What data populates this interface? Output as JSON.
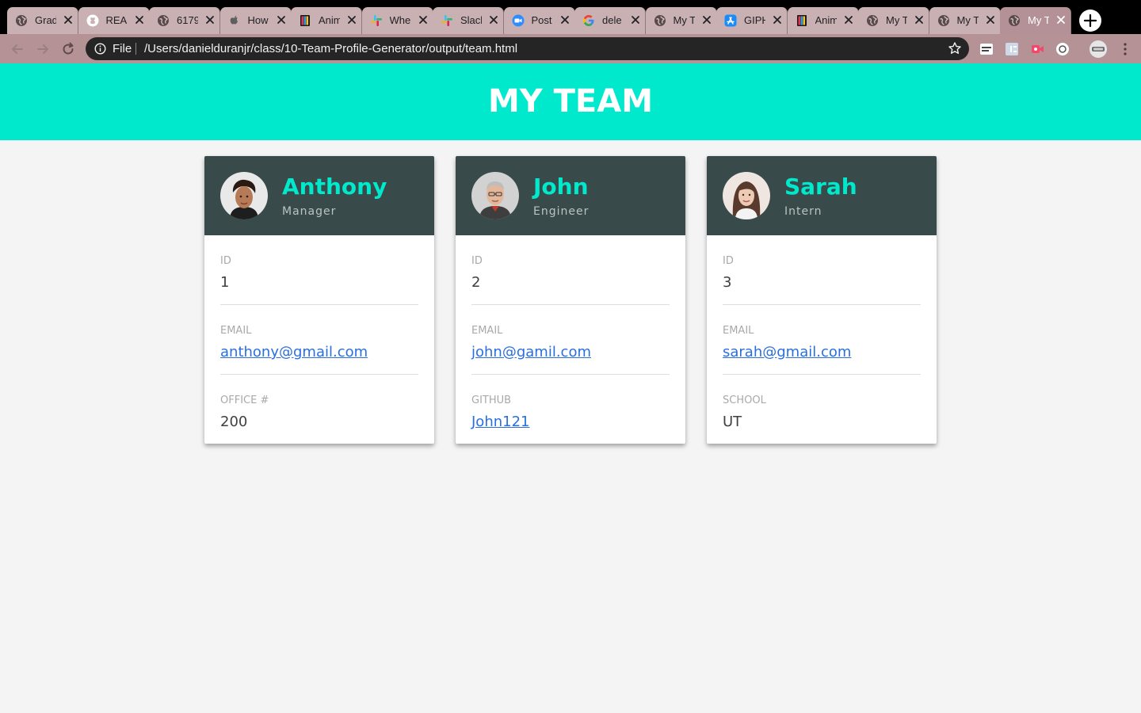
{
  "browser": {
    "tabs": [
      {
        "title": "Grad",
        "icon": "globe-icon",
        "active": false
      },
      {
        "title": "REAI",
        "icon": "github-icon",
        "active": false
      },
      {
        "title": "6179",
        "icon": "globe-icon",
        "active": false
      },
      {
        "title": "How",
        "icon": "apple-icon",
        "active": false
      },
      {
        "title": "Anim",
        "icon": "book-icon",
        "active": false
      },
      {
        "title": "Whe",
        "icon": "slack-icon",
        "active": false
      },
      {
        "title": "Slack",
        "icon": "slack-icon",
        "active": false
      },
      {
        "title": "Post",
        "icon": "zoom-icon",
        "active": false
      },
      {
        "title": "dele",
        "icon": "google-icon",
        "active": false
      },
      {
        "title": "My T",
        "icon": "globe-icon",
        "active": false
      },
      {
        "title": "GIPH",
        "icon": "appstore-icon",
        "active": false
      },
      {
        "title": "Anim",
        "icon": "book-icon",
        "active": false
      },
      {
        "title": "My T",
        "icon": "globe-icon",
        "active": false
      },
      {
        "title": "My T",
        "icon": "globe-icon",
        "active": false
      },
      {
        "title": "My T",
        "icon": "globe-icon",
        "active": true
      }
    ],
    "address": {
      "scheme_label": "File",
      "url": "/Users/danielduranjr/class/10-Team-Profile-Generator/output/team.html"
    },
    "colors": {
      "tab_strip": "#000000",
      "tab": "#c9b0b3",
      "toolbar": "#b49296",
      "omnibox": "#252525"
    }
  },
  "page": {
    "title": "MY TEAM",
    "colors": {
      "accent": "#00e9cc",
      "card_header": "#384b4a",
      "link": "#2a6fe0"
    },
    "employees": [
      {
        "name": "Anthony",
        "role": "Manager",
        "avatar": "anthony-avatar",
        "fields": [
          {
            "label": "ID",
            "value": "1",
            "link": false
          },
          {
            "label": "EMAIL",
            "value": "anthony@gmail.com",
            "link": true
          },
          {
            "label": "OFFICE #",
            "value": "200",
            "link": false
          }
        ]
      },
      {
        "name": "John",
        "role": "Engineer",
        "avatar": "john-avatar",
        "fields": [
          {
            "label": "ID",
            "value": "2",
            "link": false
          },
          {
            "label": "EMAIL",
            "value": "john@gamil.com",
            "link": true
          },
          {
            "label": "GITHUB",
            "value": "John121",
            "link": true
          }
        ]
      },
      {
        "name": "Sarah",
        "role": "Intern",
        "avatar": "sarah-avatar",
        "fields": [
          {
            "label": "ID",
            "value": "3",
            "link": false
          },
          {
            "label": "EMAIL",
            "value": "sarah@gmail.com",
            "link": true
          },
          {
            "label": "SCHOOL",
            "value": "UT",
            "link": false
          }
        ]
      }
    ]
  }
}
